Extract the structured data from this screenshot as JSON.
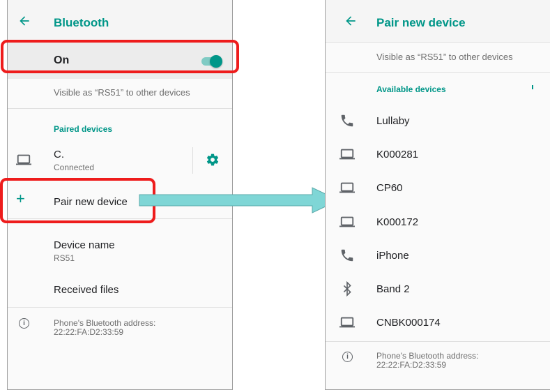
{
  "left_screen": {
    "title": "Bluetooth",
    "toggle": {
      "label": "On",
      "state": "on"
    },
    "visible_text": "Visible as “RS51” to other devices",
    "paired_header": "Paired devices",
    "paired_device": {
      "name": "C.",
      "status": "Connected",
      "icon": "laptop-icon"
    },
    "pair_new": "Pair new device",
    "device_name": {
      "title": "Device name",
      "value": "RS51"
    },
    "received_files": "Received files",
    "address": {
      "label": "Phone's Bluetooth address:",
      "value": "22:22:FA:D2:33:59"
    }
  },
  "right_screen": {
    "title": "Pair new device",
    "visible_text": "Visible as “RS51” to other devices",
    "available_header": "Available devices",
    "devices": [
      {
        "name": "Lullaby",
        "icon": "phone-icon"
      },
      {
        "name": "K000281",
        "icon": "laptop-icon"
      },
      {
        "name": "CP60",
        "icon": "laptop-icon"
      },
      {
        "name": "K000172",
        "icon": "laptop-icon"
      },
      {
        "name": "iPhone",
        "icon": "phone-icon"
      },
      {
        "name": "Band 2",
        "icon": "bluetooth-icon"
      },
      {
        "name": "CNBK000174",
        "icon": "laptop-icon"
      }
    ],
    "address": {
      "label": "Phone's Bluetooth address:",
      "value": "22:22:FA:D2:33:59"
    }
  },
  "colors": {
    "accent": "#009688",
    "highlight": "#ee1c1c",
    "arrow": "#7fd6d6"
  }
}
